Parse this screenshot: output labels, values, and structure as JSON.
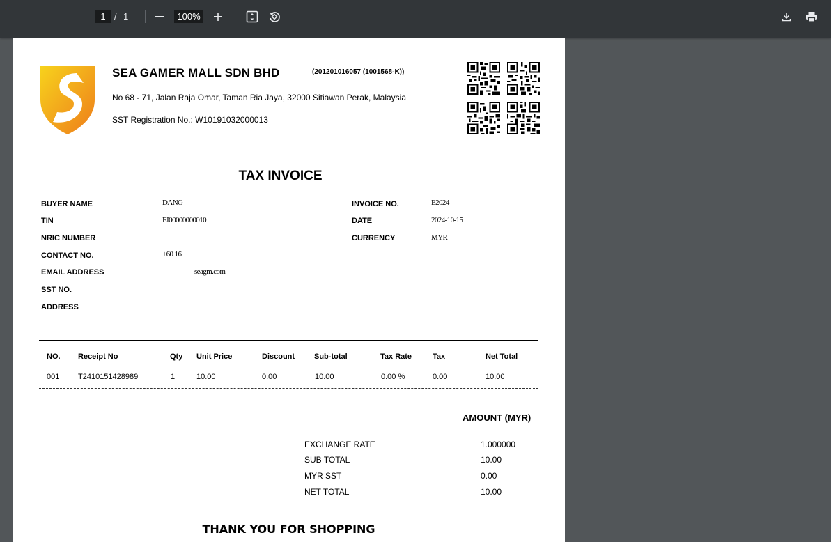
{
  "toolbar": {
    "page_current": "1",
    "page_separator": "/",
    "page_total": "1",
    "zoom": "100%"
  },
  "invoice": {
    "company_name": "SEA GAMER MALL SDN BHD",
    "registration_no": "(201201016057 (1001568-K))",
    "address": "No 68 - 71, Jalan Raja Omar, Taman Ria Jaya, 32000 Sitiawan Perak, Malaysia",
    "sst_registration": "SST Registration No.: W10191032000013",
    "title": "TAX INVOICE",
    "buyer": {
      "labels": {
        "buyer_name": "BUYER NAME",
        "tin": "TIN",
        "nric": "NRIC NUMBER",
        "contact": "CONTACT NO.",
        "email": "EMAIL ADDRESS",
        "sst_no": "SST NO.",
        "address": "ADDRESS"
      },
      "values": {
        "buyer_name": "DANG",
        "tin": "EI00000000010",
        "nric": "",
        "contact": "+60 16",
        "email": "seagm.com",
        "sst_no": "",
        "address": ""
      }
    },
    "meta": {
      "labels": {
        "invoice_no": "INVOICE NO.",
        "date": "DATE",
        "currency": "CURRENCY"
      },
      "values": {
        "invoice_no": "E2024",
        "date": "2024-10-15",
        "currency": "MYR"
      }
    },
    "table": {
      "headers": [
        "NO.",
        "Receipt No",
        "Qty",
        "Unit Price",
        "Discount",
        "Sub-total",
        "Tax Rate",
        "Tax",
        "Net Total"
      ],
      "rows": [
        [
          "001",
          "T2410151428989",
          "1",
          "10.00",
          "0.00",
          "10.00",
          "0.00 %",
          "0.00",
          "10.00"
        ]
      ]
    },
    "summary": {
      "heading": "AMOUNT (MYR)",
      "rows": [
        {
          "label": "EXCHANGE RATE",
          "value": "1.000000"
        },
        {
          "label": "SUB TOTAL",
          "value": "10.00"
        },
        {
          "label": "MYR SST",
          "value": "0.00"
        },
        {
          "label": "NET TOTAL",
          "value": "10.00"
        }
      ]
    },
    "thanks": "THANK YOU FOR SHOPPING"
  },
  "colors": {
    "toolbar_bg": "#323639",
    "viewer_bg": "#525659",
    "logo_orange": "#f08a1c",
    "logo_yellow": "#f5c518"
  },
  "icons": [
    "minus-icon",
    "plus-icon",
    "fit-page-icon",
    "rotate-icon",
    "download-icon",
    "print-icon"
  ]
}
